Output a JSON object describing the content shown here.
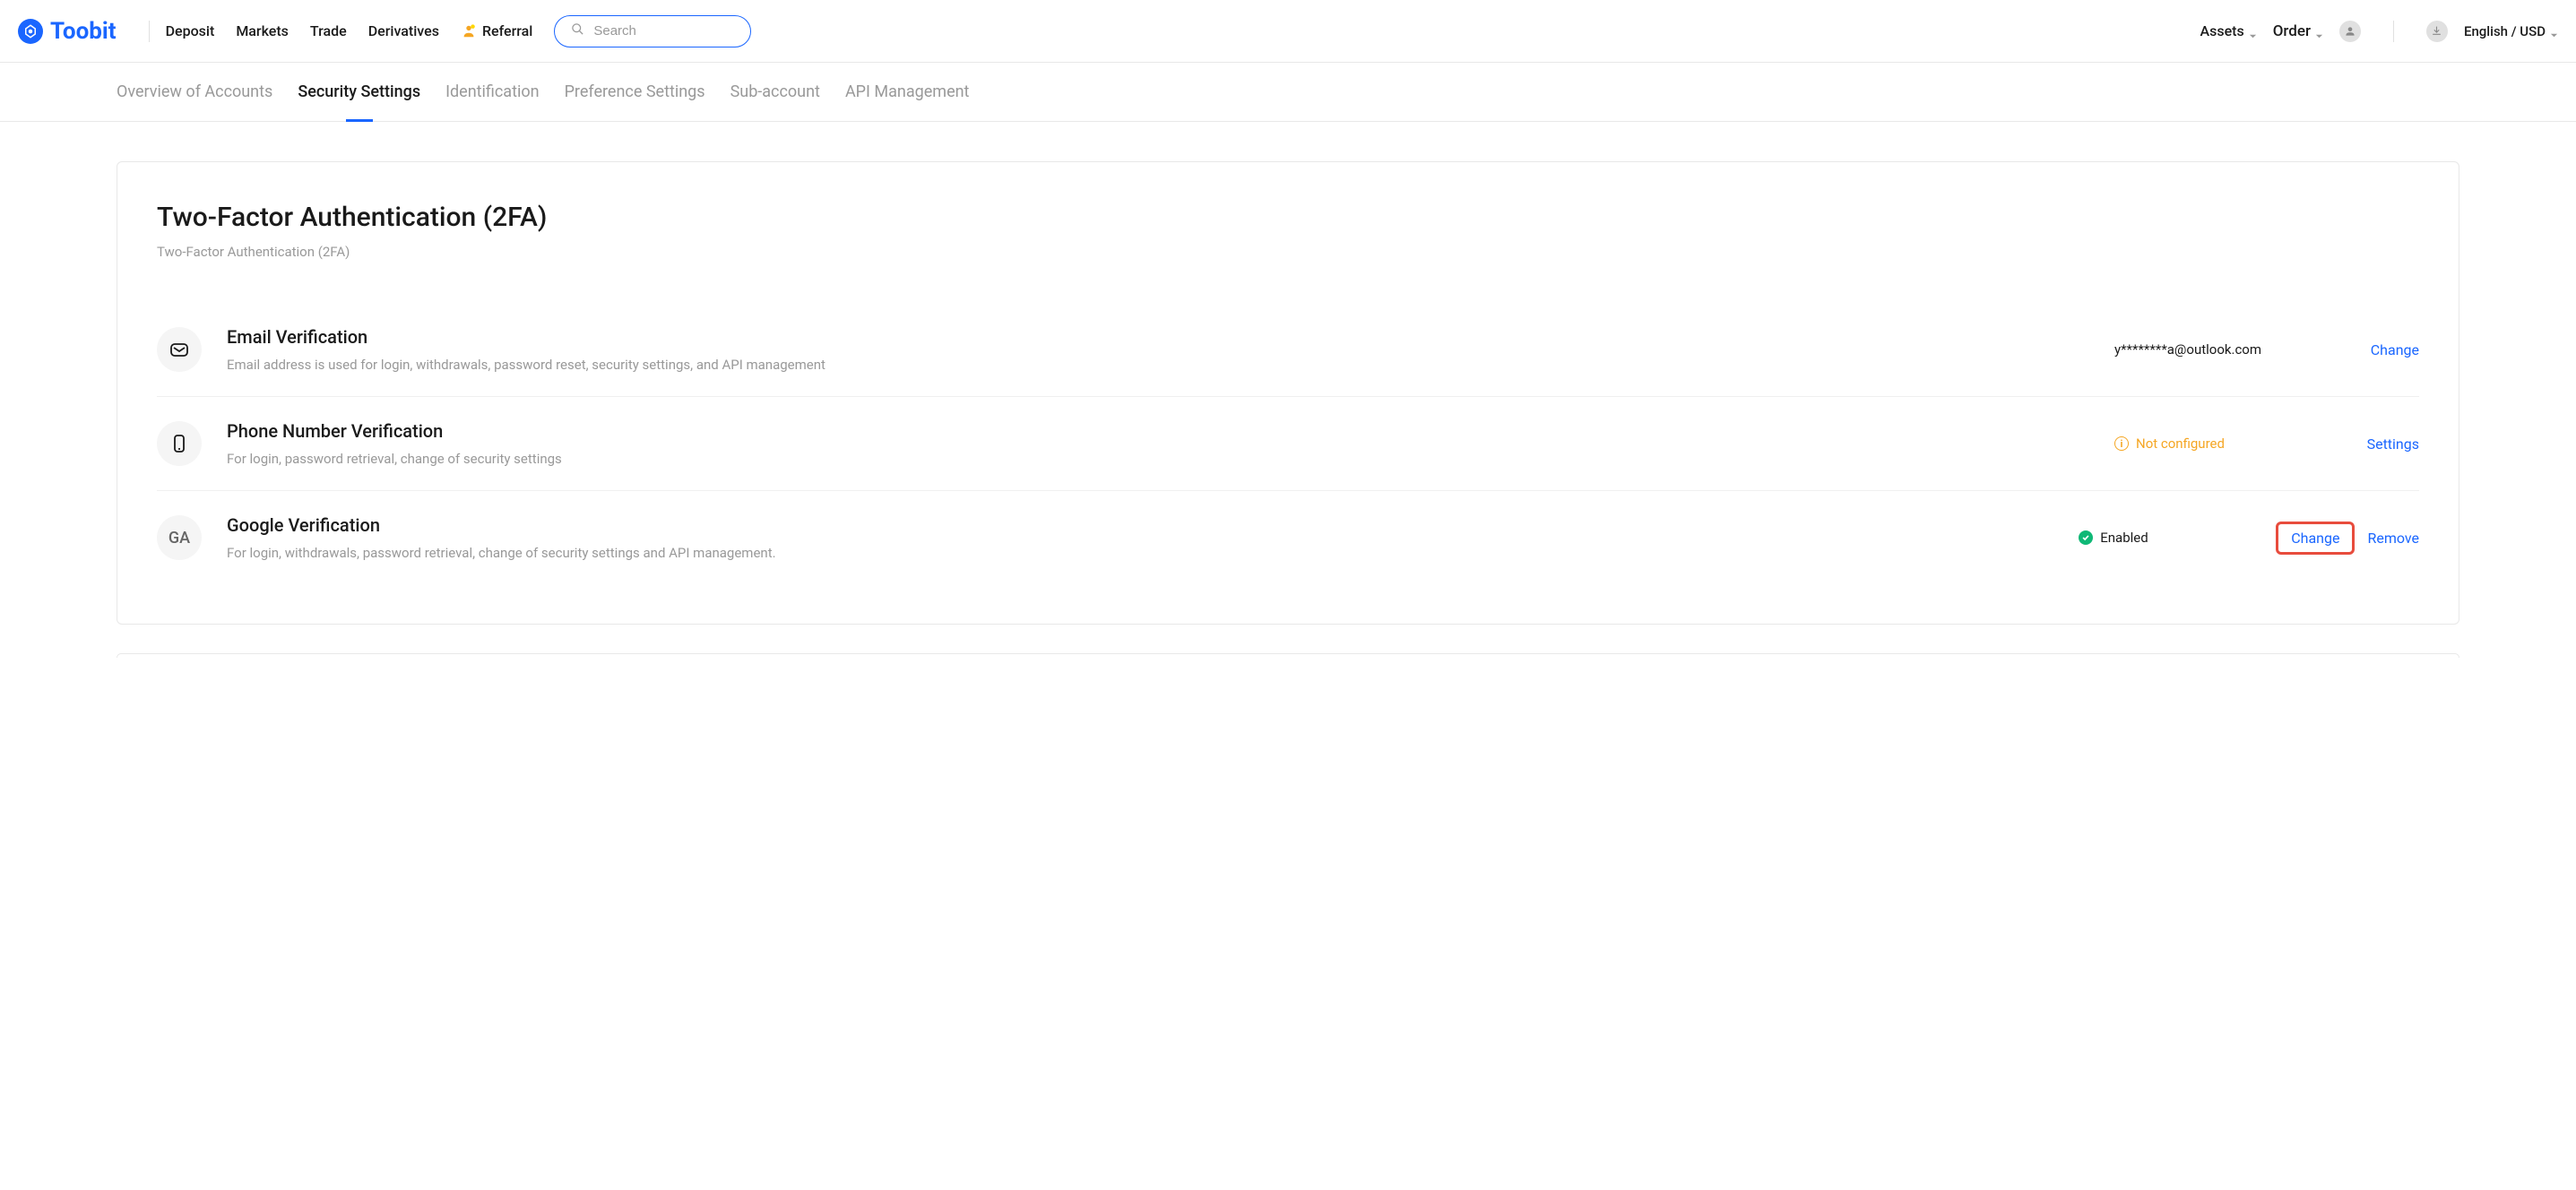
{
  "header": {
    "brand": "Toobit",
    "nav": {
      "deposit": "Deposit",
      "markets": "Markets",
      "trade": "Trade",
      "derivatives": "Derivatives",
      "referral": "Referral"
    },
    "search_placeholder": "Search",
    "assets": "Assets",
    "order": "Order",
    "lang_currency": "English / USD"
  },
  "tabs": {
    "overview": "Overview of Accounts",
    "security": "Security Settings",
    "identification": "Identification",
    "preference": "Preference Settings",
    "subaccount": "Sub-account",
    "api": "API Management"
  },
  "card": {
    "title": "Two-Factor Authentication (2FA)",
    "subtitle": "Two-Factor Authentication (2FA)",
    "rows": {
      "email": {
        "title": "Email Verification",
        "desc": "Email address is used for login, withdrawals, password reset, security settings, and API management",
        "value": "y********a@outlook.com",
        "action": "Change"
      },
      "phone": {
        "title": "Phone Number Verification",
        "desc": "For login, password retrieval, change of security settings",
        "status": "Not configured",
        "action": "Settings"
      },
      "google": {
        "title": "Google Verification",
        "desc": "For login, withdrawals, password retrieval, change of security settings and API management.",
        "status": "Enabled",
        "action1": "Change",
        "action2": "Remove"
      }
    }
  }
}
